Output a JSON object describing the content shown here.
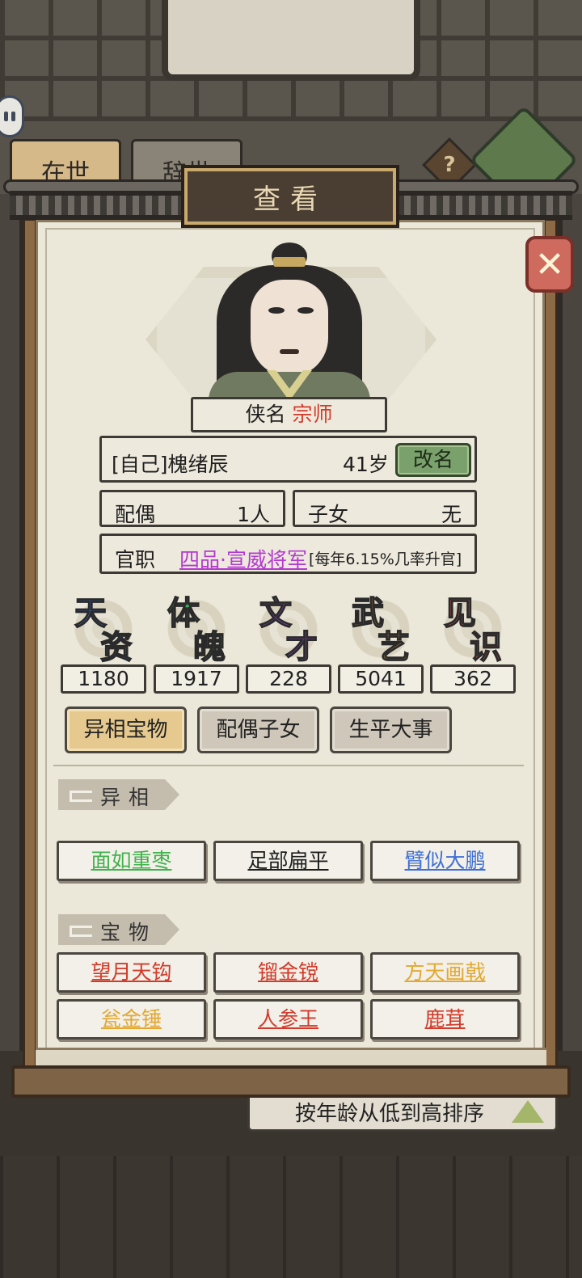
{
  "background": {
    "tabs": [
      "在世",
      "辞世"
    ],
    "help_glyph": "?",
    "sort_label": "按年龄从低到高排序"
  },
  "dialog": {
    "title": "查看",
    "close_glyph": "✕",
    "hero": {
      "title_label": "侠名",
      "title_value": "宗师",
      "name": "[自己]槐绪辰",
      "age": "41岁",
      "rename_label": "改名",
      "spouse_label": "配偶",
      "spouse_value": "1人",
      "children_label": "子女",
      "children_value": "无",
      "office_label": "官职",
      "office_title": "四品·宣威将军",
      "office_note": "[每年6.15%几率升官]"
    },
    "stats": [
      {
        "c1": "天",
        "c2": "资",
        "value": "1180",
        "color": "#3e6fd6"
      },
      {
        "c1": "体",
        "c2": "魄",
        "value": "1917",
        "color": "#3fae5e"
      },
      {
        "c1": "文",
        "c2": "才",
        "value": "228",
        "color": "#9a4fd1"
      },
      {
        "c1": "武",
        "c2": "艺",
        "value": "5041",
        "color": "#e3a832"
      },
      {
        "c1": "见",
        "c2": "识",
        "value": "362",
        "color": "#e0564a"
      }
    ],
    "tabs": [
      "异相宝物",
      "配偶子女",
      "生平大事"
    ],
    "active_tab": "异相宝物",
    "traits_section": "异相",
    "traits": [
      {
        "label": "面如重枣",
        "color": "#42b24e"
      },
      {
        "label": "足部扁平",
        "color": "#1e1e1e"
      },
      {
        "label": "臂似大鹏",
        "color": "#3f6fd6"
      }
    ],
    "treasures_section": "宝物",
    "treasures": [
      {
        "label": "望月天钩",
        "color": "#d23a2a"
      },
      {
        "label": "镏金镋",
        "color": "#d23a2a"
      },
      {
        "label": "方天画戟",
        "color": "#e3a832"
      },
      {
        "label": "瓮金锤",
        "color": "#e3a832"
      },
      {
        "label": "人参王",
        "color": "#d23a2a"
      },
      {
        "label": "鹿茸",
        "color": "#d23a2a"
      }
    ]
  }
}
